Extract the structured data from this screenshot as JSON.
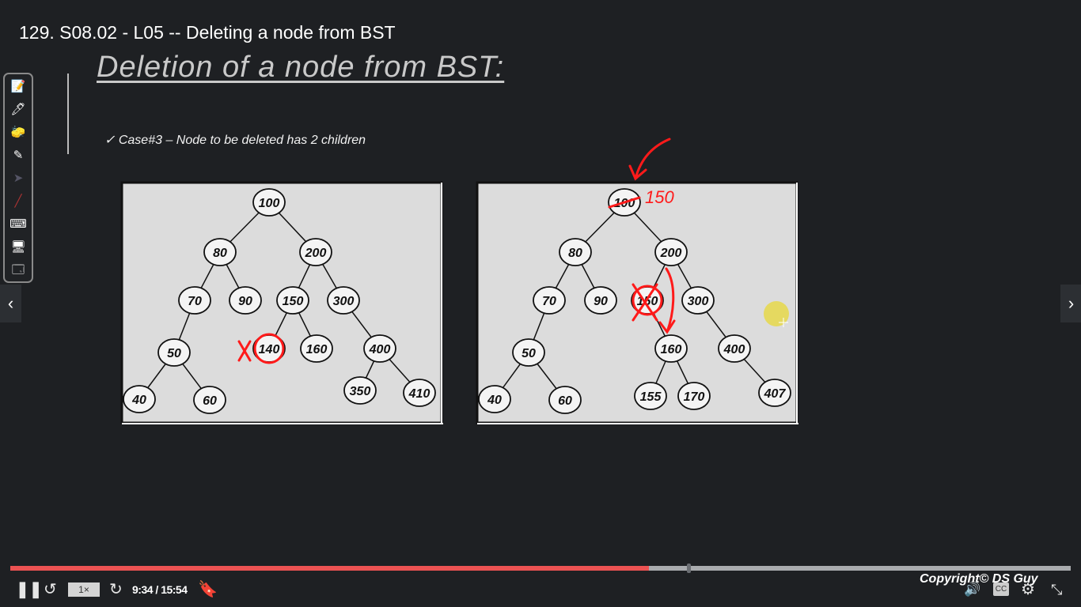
{
  "video": {
    "title": "129. S08.02 - L05 -- Deleting a node from BST"
  },
  "slide": {
    "heading": "Deletion of a node from BST:",
    "case": "✓ Case#3 – Node to be deleted has 2 children",
    "left_tree": {
      "nodes": [
        "100",
        "80",
        "200",
        "70",
        "90",
        "150",
        "300",
        "50",
        "140",
        "160",
        "400",
        "40",
        "60",
        "350",
        "410"
      ]
    },
    "right_tree": {
      "nodes": [
        "100",
        "80",
        "200",
        "70",
        "90",
        "150",
        "300",
        "50",
        "160",
        "400",
        "40",
        "60",
        "155",
        "170",
        "407"
      ]
    },
    "annotation_replacement": "150",
    "annotation_color": "#ff1a1a"
  },
  "toolbar": {
    "tools": [
      "whiteboard-icon",
      "pen-icon",
      "eraser-icon",
      "highlighter-icon",
      "pointer-icon",
      "laser-icon",
      "keyboard-icon",
      "screen-icon",
      "screen-share-icon"
    ]
  },
  "player": {
    "current_time": "9:34",
    "duration": "15:54",
    "time_label": "9:34 / 15:54",
    "progress_fraction": 0.602,
    "speed": "1×",
    "copyright": "Copyright© DS Guy",
    "cc_label": "CC",
    "accent_color": "#ec5252"
  }
}
